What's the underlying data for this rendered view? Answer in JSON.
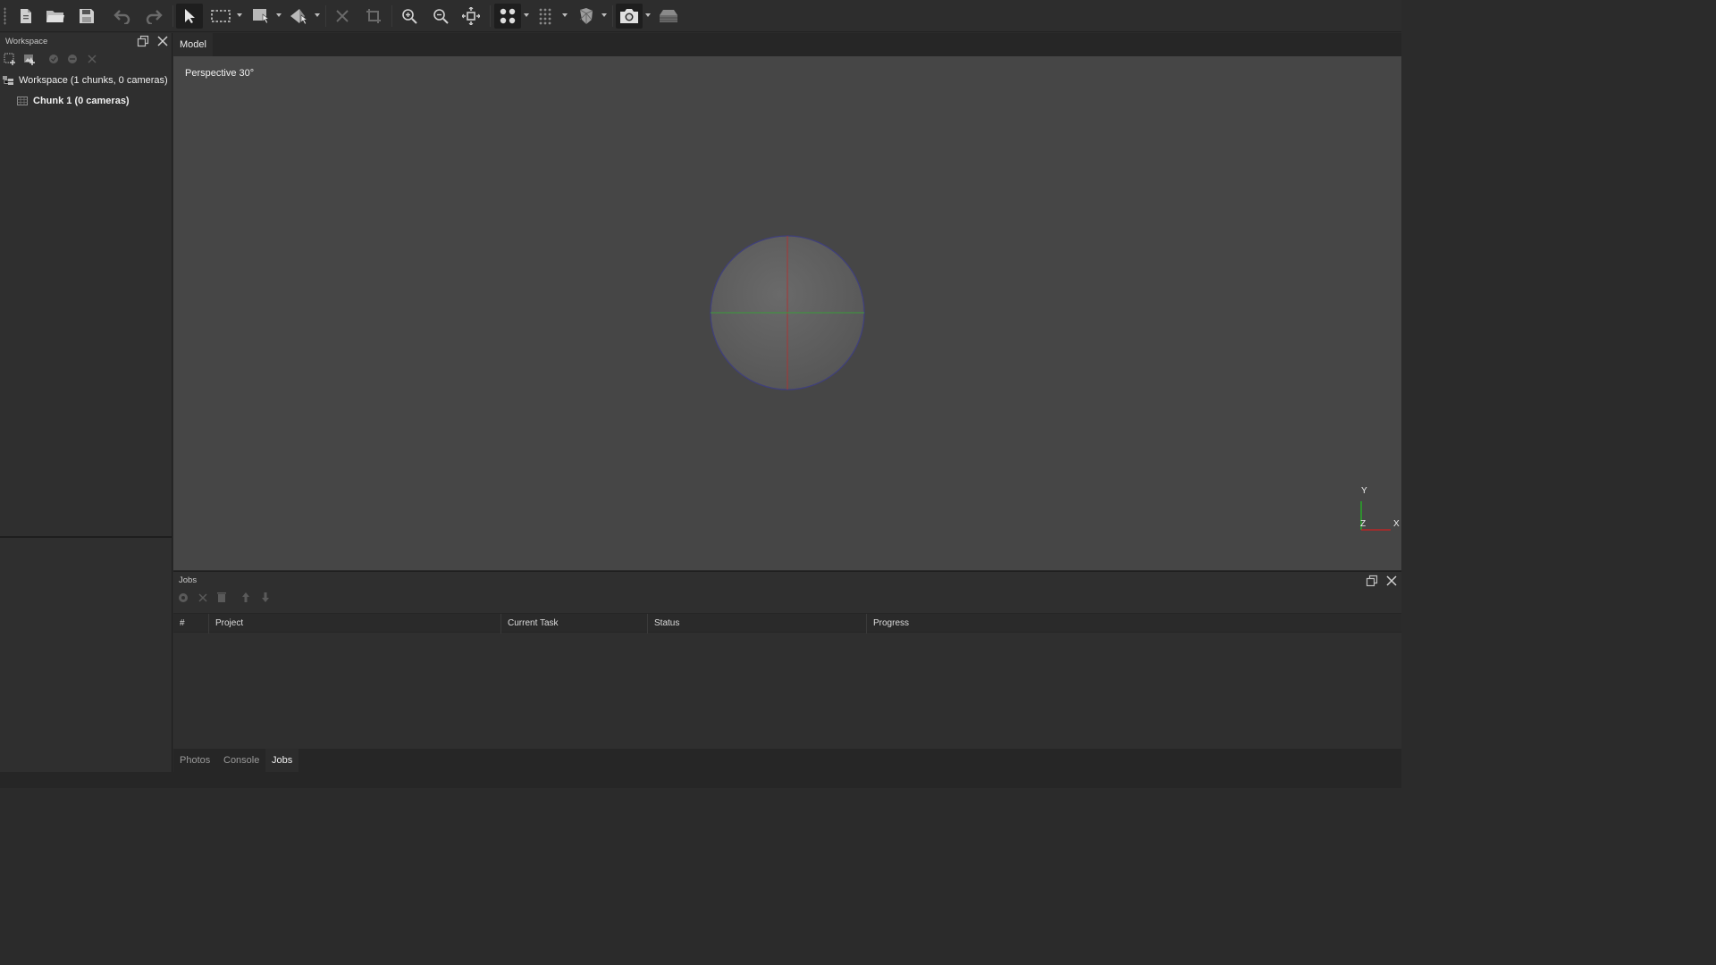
{
  "toolbar": {
    "items": [
      {
        "name": "new-icon",
        "interactable": true
      },
      {
        "name": "open-folder-icon",
        "interactable": true
      },
      {
        "name": "save-icon",
        "interactable": true
      },
      {
        "name": "undo-icon",
        "interactable": true
      },
      {
        "name": "redo-icon",
        "interactable": true
      },
      {
        "name": "navigation-arrow-icon",
        "interactable": true
      },
      {
        "name": "rectangle-selection-icon",
        "interactable": true
      },
      {
        "name": "model-tool-icon",
        "interactable": true
      },
      {
        "name": "shape-tool-icon",
        "interactable": true
      },
      {
        "name": "delete-selection-icon",
        "interactable": true
      },
      {
        "name": "crop-selection-icon",
        "interactable": true
      },
      {
        "name": "zoom-in-icon",
        "interactable": true
      },
      {
        "name": "zoom-out-icon",
        "interactable": true
      },
      {
        "name": "reset-view-icon",
        "interactable": true
      },
      {
        "name": "points-icon",
        "interactable": true
      },
      {
        "name": "dense-cloud-icon",
        "interactable": true
      },
      {
        "name": "mesh-shading-icon",
        "interactable": true
      },
      {
        "name": "show-cameras-icon",
        "interactable": true
      },
      {
        "name": "show-region-icon",
        "interactable": true
      }
    ]
  },
  "workspace": {
    "title": "Workspace",
    "root_label": "Workspace (1 chunks, 0 cameras)",
    "chunk_label": "Chunk 1 (0 cameras)"
  },
  "model": {
    "tab_label": "Model",
    "view_label": "Perspective 30°",
    "axes": {
      "y": "Y",
      "z": "Z",
      "x": "X"
    }
  },
  "jobs": {
    "title": "Jobs",
    "columns": [
      "#",
      "Project",
      "Current Task",
      "Status",
      "Progress"
    ],
    "rows": []
  },
  "bottom_tabs": [
    "Photos",
    "Console",
    "Jobs"
  ],
  "active_bottom_tab": "Jobs",
  "colors": {
    "viewport_bg": "#464646",
    "panel_bg": "#2f2f2f",
    "axis_x": "#d02020",
    "axis_y": "#20c020",
    "sphere_outline": "#3a3a7a"
  }
}
